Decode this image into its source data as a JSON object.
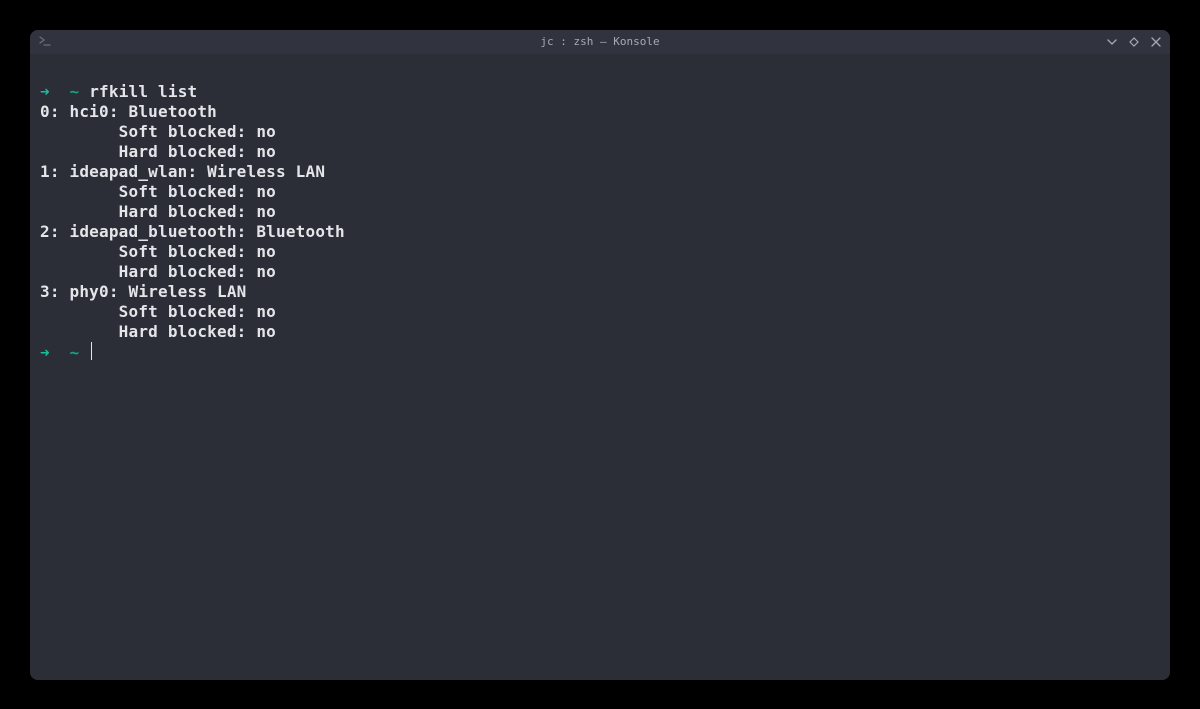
{
  "window": {
    "title": "jc : zsh — Konsole"
  },
  "prompt": {
    "arrow": "➜",
    "tilde": "~"
  },
  "command": "rfkill list",
  "entries": [
    {
      "index": "0",
      "device": "hci0",
      "type": "Bluetooth",
      "soft_blocked_label": "Soft blocked:",
      "soft_blocked": "no",
      "hard_blocked_label": "Hard blocked:",
      "hard_blocked": "no"
    },
    {
      "index": "1",
      "device": "ideapad_wlan",
      "type": "Wireless LAN",
      "soft_blocked_label": "Soft blocked:",
      "soft_blocked": "no",
      "hard_blocked_label": "Hard blocked:",
      "hard_blocked": "no"
    },
    {
      "index": "2",
      "device": "ideapad_bluetooth",
      "type": "Bluetooth",
      "soft_blocked_label": "Soft blocked:",
      "soft_blocked": "no",
      "hard_blocked_label": "Hard blocked:",
      "hard_blocked": "no"
    },
    {
      "index": "3",
      "device": "phy0",
      "type": "Wireless LAN",
      "soft_blocked_label": "Soft blocked:",
      "soft_blocked": "no",
      "hard_blocked_label": "Hard blocked:",
      "hard_blocked": "no"
    }
  ]
}
